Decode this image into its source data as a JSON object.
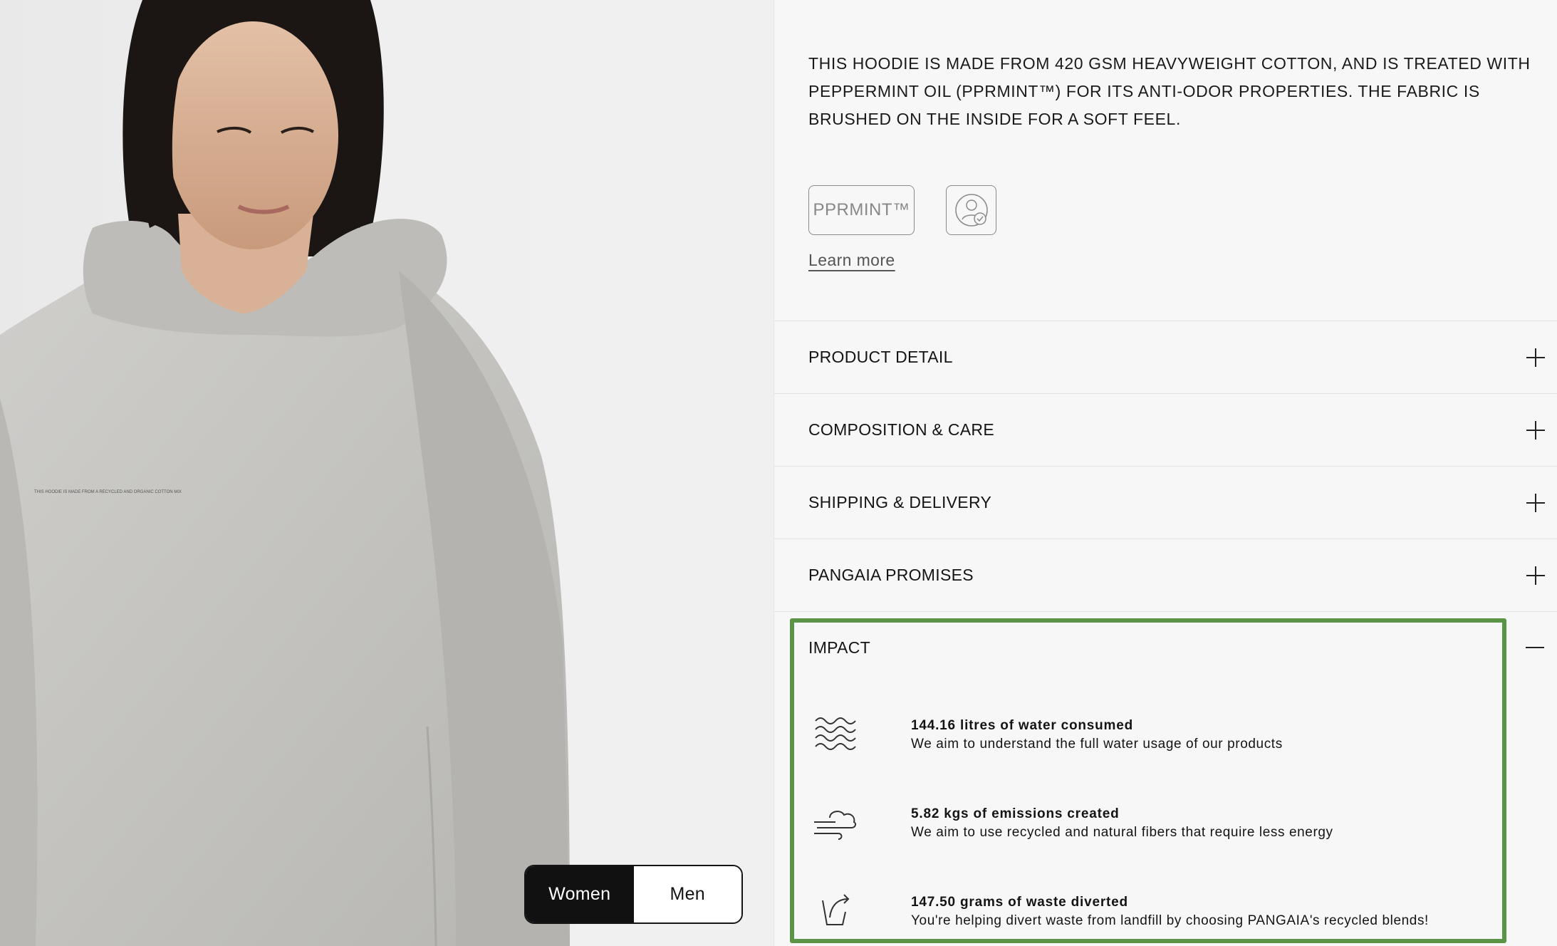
{
  "product": {
    "description": "This hoodie is made from 420 GSM heavyweight cotton, and is treated with peppermint oil (PPRMINT™) for its anti-odor properties. The fabric is brushed on the inside for a soft feel.",
    "badge_text": "PPRMINT™",
    "badge_icon": "person-check-icon",
    "learn_more": "Learn more",
    "chest_print": "THIS HOODIE IS MADE FROM A RECYCLED AND ORGANIC COTTON MIX"
  },
  "gender_toggle": {
    "options": [
      "Women",
      "Men"
    ],
    "selected": "Women"
  },
  "accordion": {
    "items": [
      {
        "label": "PRODUCT DETAIL",
        "expanded": false
      },
      {
        "label": "COMPOSITION & CARE",
        "expanded": false
      },
      {
        "label": "SHIPPING & DELIVERY",
        "expanded": false
      },
      {
        "label": "PANGAIA PROMISES",
        "expanded": false
      }
    ],
    "impact": {
      "label": "IMPACT",
      "expanded": true,
      "items": [
        {
          "icon": "water-waves-icon",
          "title": "144.16 litres of water consumed",
          "text": "We aim to understand the full water usage of our products"
        },
        {
          "icon": "wind-cloud-icon",
          "title": "5.82 kgs of emissions created",
          "text": "We aim to use recycled and natural fibers that require less energy"
        },
        {
          "icon": "waste-divert-icon",
          "title": "147.50 grams of waste diverted",
          "text": "You're helping divert waste from landfill by choosing PANGAIA's recycled blends!"
        }
      ]
    }
  },
  "colors": {
    "highlight": "#5b9447",
    "background": "#f7f7f7",
    "hoodie": "#c4c3bf",
    "toggle_active": "#111111"
  }
}
